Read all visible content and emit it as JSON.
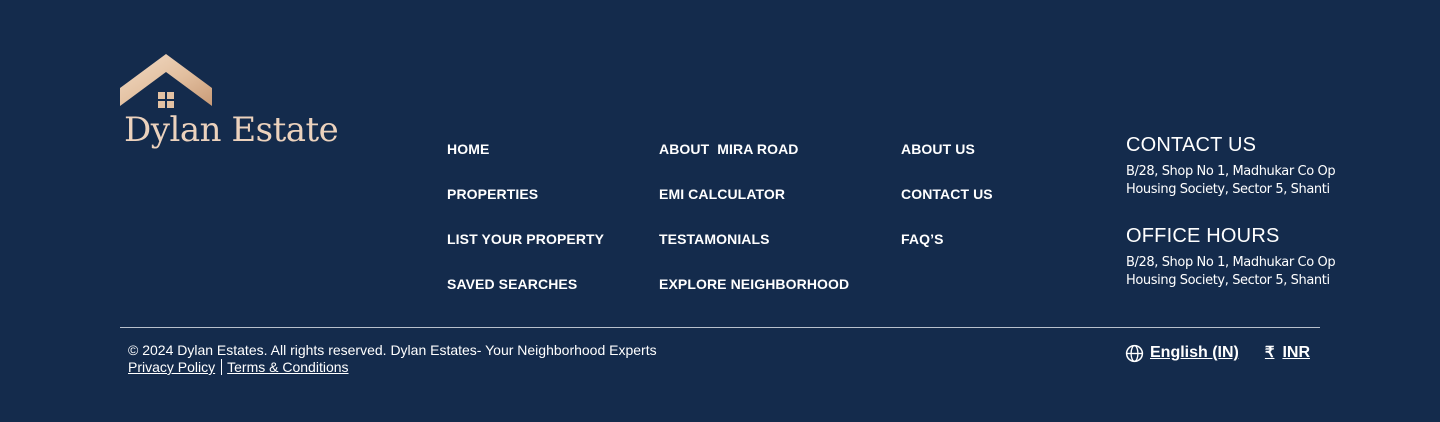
{
  "brand": {
    "name": "Dylan Estate",
    "logo_icon": "house-roof-icon",
    "logo_color": "#ecd2bd"
  },
  "nav": {
    "column1": [
      {
        "label": "HOME"
      },
      {
        "label": "PROPERTIES"
      },
      {
        "label": "LIST YOUR PROPERTY"
      },
      {
        "label": "SAVED SEARCHES"
      }
    ],
    "column2": [
      {
        "label": "ABOUT  MIRA ROAD"
      },
      {
        "label": "EMI CALCULATOR"
      },
      {
        "label": "TESTAMONIALS"
      },
      {
        "label": "EXPLORE NEIGHBORHOOD"
      }
    ],
    "column3": [
      {
        "label": "ABOUT US"
      },
      {
        "label": "CONTACT US"
      },
      {
        "label": "FAQ’S"
      }
    ]
  },
  "contact": {
    "title": "CONTACT US",
    "address": "B/28, Shop No 1, Madhukar Co Op Housing Society, Sector 5, Shanti",
    "hours_title": "OFFICE HOURS",
    "hours_text": "B/28, Shop No 1, Madhukar Co Op Housing Society, Sector 5, Shanti"
  },
  "footer": {
    "copyright": "© 2024 Dylan Estates. All rights reserved. Dylan Estates- Your Neighborhood Experts",
    "privacy_label": "Privacy Policy",
    "terms_label": "Terms & Conditions",
    "language_label": "English (IN)",
    "language_icon": "globe-icon",
    "currency_symbol": "₹",
    "currency_label": "INR"
  },
  "colors": {
    "background": "#142b4c",
    "accent": "#ecd2bd",
    "divider": "#b8c0cc",
    "text": "#ffffff"
  }
}
